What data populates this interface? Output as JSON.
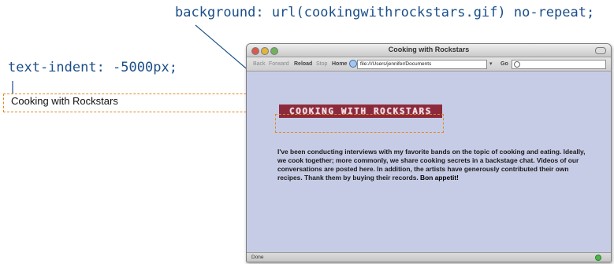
{
  "callouts": {
    "background_rule": "background: url(cookingwithrockstars.gif) no-repeat;",
    "indent_rule": "text-indent: -5000px;"
  },
  "offscreen_text": "Cooking with Rockstars",
  "browser": {
    "window_title": "Cooking with Rockstars",
    "toolbar": {
      "back": "Back",
      "forward": "Forward",
      "reload": "Reload",
      "stop": "Stop",
      "home": "Home",
      "url": "file:///Users/jennifer/Documents",
      "go": "Go"
    },
    "heading_image_text": "COOKING WITH ROCKSTARS",
    "paragraph": "I've been conducting interviews with my favorite bands on the topic of cooking and eating. Ideally, we cook together; more commonly, we share cooking secrets in a backstage chat. Videos of our conversations are posted here. In addition, the artists have generously contributed their own recipes. Thank them by buying their records.",
    "paragraph_emphasis": "Bon appetit!",
    "status": "Done"
  },
  "colors": {
    "callout_text": "#1b4f8a",
    "dashed_outline": "#e08a22",
    "page_background": "#c7cce6",
    "banner_background": "#8c2a3c"
  }
}
